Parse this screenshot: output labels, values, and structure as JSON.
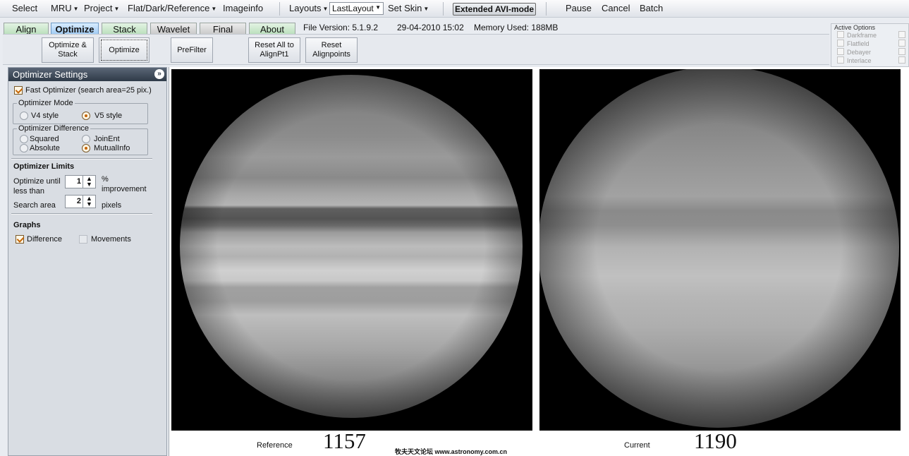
{
  "menu": {
    "select": "Select",
    "mru": "MRU",
    "project": "Project",
    "flat_dark_reference": "Flat/Dark/Reference",
    "imageinfo": "Imageinfo",
    "layouts": "Layouts",
    "layout_value": "LastLayout",
    "set_skin": "Set Skin",
    "extended_avi": "Extended AVI-mode",
    "pause": "Pause",
    "cancel": "Cancel",
    "batch": "Batch"
  },
  "tabs": [
    {
      "label": "Align"
    },
    {
      "label": "Optimize"
    },
    {
      "label": "Stack"
    },
    {
      "label": "Wavelet"
    },
    {
      "label": "Final"
    },
    {
      "label": "About"
    }
  ],
  "status": {
    "file_version": "File Version: 5.1.9.2",
    "datetime": "29-04-2010 15:02",
    "memory": "Memory Used: 188MB"
  },
  "toolbar": {
    "optimize_stack": "Optimize & Stack",
    "optimize": "Optimize",
    "prefilter": "PreFilter",
    "reset_all": "Reset All to AlignPt1",
    "reset_alignpoints": "Reset Alignpoints"
  },
  "active_options": {
    "title": "Active Options",
    "items": [
      "Darkframe",
      "Flatfield",
      "Debayer",
      "Interlace"
    ]
  },
  "panel": {
    "title": "Optimizer Settings",
    "fast_optimizer": "Fast Optimizer (search area=25 pix.)",
    "mode_group": "Optimizer Mode",
    "mode_v4": "V4 style",
    "mode_v5": "V5 style",
    "diff_group": "Optimizer Difference",
    "diff_squared": "Squared",
    "diff_joinent": "JoinEnt",
    "diff_absolute": "Absolute",
    "diff_mutualinfo": "MutualInfo",
    "limits_title": "Optimizer Limits",
    "optimize_until": "Optimize until",
    "less_than": "less than",
    "improvement_value": "1",
    "percent": "%",
    "improvement": "improvement",
    "search_area": "Search area",
    "search_value": "2",
    "pixels": "pixels",
    "graphs_title": "Graphs",
    "difference": "Difference",
    "movements": "Movements"
  },
  "viewer": {
    "reference_label": "Reference",
    "reference_frame": "1157",
    "current_label": "Current",
    "current_frame": "1190",
    "watermark": "牧夫天文论坛 www.astronomy.com.cn"
  }
}
